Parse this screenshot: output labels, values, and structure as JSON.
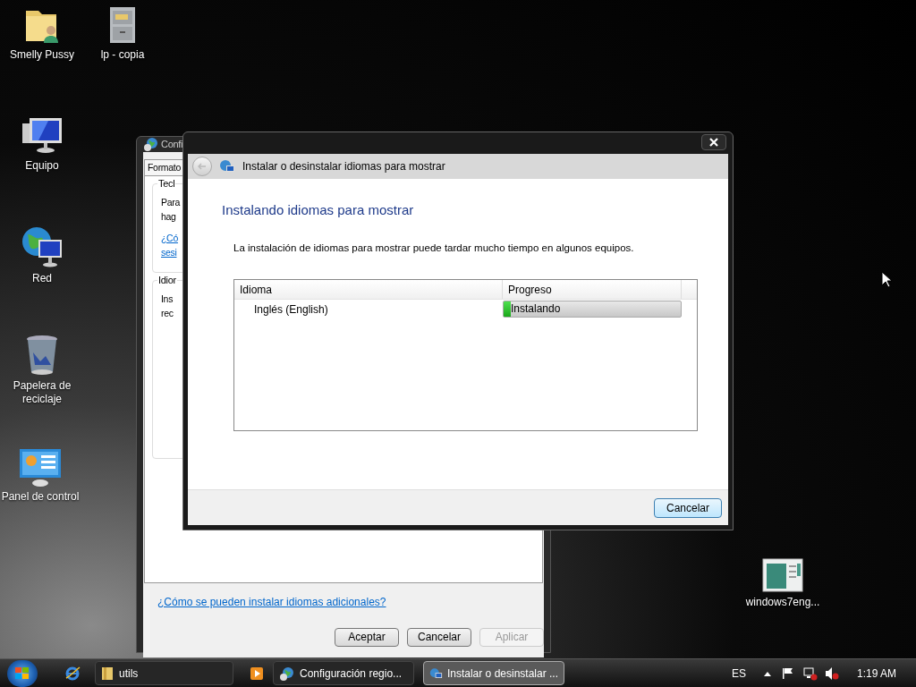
{
  "desktop_icons": [
    {
      "label": "Smelly Pussy",
      "kind": "user-folder"
    },
    {
      "label": "lp - copia",
      "kind": "cabinet"
    },
    {
      "label": "Equipo",
      "kind": "computer"
    },
    {
      "label": "Red",
      "kind": "network"
    },
    {
      "label": "Papelera de reciclaje",
      "kind": "bin"
    },
    {
      "label": "Panel de control",
      "kind": "control-panel"
    },
    {
      "label": "windows7eng...",
      "kind": "document"
    }
  ],
  "back_window": {
    "title": "Confi",
    "tab": "Formato",
    "groups": [
      {
        "title": "Tecl",
        "lines": [
          "Para",
          "hag"
        ],
        "links": [
          "¿Có",
          "sesi"
        ]
      },
      {
        "title": "Idior",
        "lines": [
          "Ins",
          "rec"
        ]
      }
    ],
    "link": "¿Cómo se pueden instalar idiomas adicionales?",
    "buttons": [
      {
        "label": "Aceptar",
        "disabled": false
      },
      {
        "label": "Cancelar",
        "disabled": false
      },
      {
        "label": "Aplicar",
        "disabled": true
      }
    ]
  },
  "dialog": {
    "nav_title": "Instalar o desinstalar idiomas para mostrar",
    "heading": "Instalando idiomas para mostrar",
    "description": "La instalación de idiomas para mostrar puede tardar mucho tiempo en algunos equipos.",
    "columns": [
      "Idioma",
      "Progreso"
    ],
    "rows": [
      {
        "language": "Inglés (English)",
        "status": "Instalando",
        "level": 0.04
      }
    ],
    "button": "Cancelar"
  },
  "taskbar": {
    "items": [
      {
        "label": "utils",
        "kind": "folder",
        "selected": false
      },
      {
        "label": "Configuración regio...",
        "kind": "globe",
        "selected": false
      },
      {
        "label": "Instalar o desinstalar ...",
        "kind": "globe-monitor",
        "selected": true
      }
    ],
    "language": "ES",
    "time": "1:19 AM"
  }
}
